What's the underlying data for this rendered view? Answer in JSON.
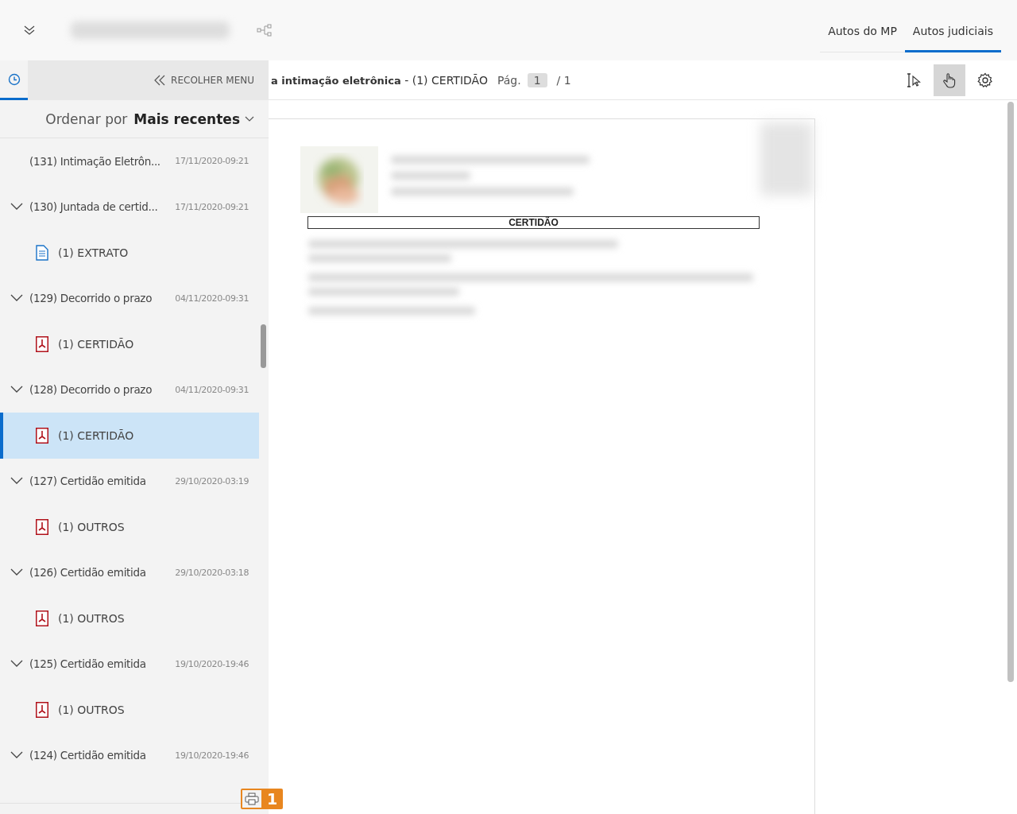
{
  "tabs": [
    {
      "label": "Autos do MP",
      "selected": false
    },
    {
      "label": "Autos judiciais",
      "selected": true
    }
  ],
  "sidebar": {
    "history_tab": {
      "selected": true
    },
    "collapse_button": "RECOLHER MENU",
    "sort_label": "Ordenar por",
    "sort_value": "Mais recentes",
    "items": [
      {
        "label": "(131) Intimação Eletrôn...",
        "date": "17/11/2020-09:21",
        "chevron": false
      },
      {
        "label": "(130) Juntada de certid...",
        "date": "17/11/2020-09:21",
        "chevron": true,
        "children": [
          {
            "label": "(1) EXTRATO",
            "kind": "text",
            "selected": false
          }
        ]
      },
      {
        "label": "(129) Decorrido o prazo",
        "date": "04/11/2020-09:31",
        "chevron": true,
        "children": [
          {
            "label": "(1) CERTIDÃO",
            "kind": "pdf",
            "selected": false
          }
        ]
      },
      {
        "label": "(128) Decorrido o prazo",
        "date": "04/11/2020-09:31",
        "chevron": true,
        "children": [
          {
            "label": "(1) CERTIDÃO",
            "kind": "pdf",
            "selected": true
          }
        ]
      },
      {
        "label": "(127) Certidão emitida",
        "date": "29/10/2020-03:19",
        "chevron": true,
        "children": [
          {
            "label": "(1) OUTROS",
            "kind": "pdf",
            "selected": false
          }
        ]
      },
      {
        "label": "(126) Certidão emitida",
        "date": "29/10/2020-03:18",
        "chevron": true,
        "children": [
          {
            "label": "(1) OUTROS",
            "kind": "pdf",
            "selected": false
          }
        ]
      },
      {
        "label": "(125) Certidão emitida",
        "date": "19/10/2020-19:46",
        "chevron": true,
        "children": [
          {
            "label": "(1) OUTROS",
            "kind": "pdf",
            "selected": false
          }
        ]
      },
      {
        "label": "(124) Certidão emitida",
        "date": "19/10/2020-19:46",
        "chevron": true
      }
    ]
  },
  "viewer": {
    "title": "**a intimação eletrônica** - (1) CERTIDÃO",
    "page_label": "Pág.",
    "page": "1",
    "page_total": "/ 1",
    "tools": [
      {
        "kind": "text-select",
        "selected": false
      },
      {
        "kind": "hand",
        "selected": true
      },
      {
        "kind": "settings",
        "selected": false
      }
    ],
    "document": {
      "heading": "CERTIDÃO"
    }
  },
  "print_badge": {
    "count": "1"
  }
}
